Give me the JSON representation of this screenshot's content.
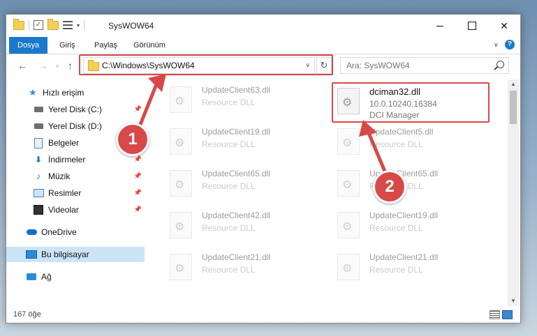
{
  "window": {
    "title": "SysWOW64",
    "min_symbol": "—",
    "close_symbol": "✕"
  },
  "ribbon": {
    "tabs": [
      {
        "label": "Dosya",
        "active": true
      },
      {
        "label": "Giriş",
        "active": false
      },
      {
        "label": "Paylaş",
        "active": false
      },
      {
        "label": "Görünüm",
        "active": false
      }
    ],
    "help_label": "?"
  },
  "navigation": {
    "back_icon": "←",
    "forward_icon": "→",
    "up_icon": "↑",
    "address": "C:\\Windows\\SysWOW64",
    "refresh_icon": "↻",
    "search_placeholder": "Ara: SysWOW64"
  },
  "sidebar": {
    "items": [
      {
        "label": "Hızlı erişim",
        "icon": "star-icon"
      },
      {
        "label": "Yerel Disk (C:)",
        "icon": "drive-icon",
        "pinned": true
      },
      {
        "label": "Yerel Disk (D:)",
        "icon": "drive-icon",
        "pinned": false
      },
      {
        "label": "Belgeler",
        "icon": "documents-icon",
        "pinned": true
      },
      {
        "label": "İndirmeler",
        "icon": "downloads-icon",
        "pinned": true
      },
      {
        "label": "Müzik",
        "icon": "music-icon",
        "pinned": true
      },
      {
        "label": "Resimler",
        "icon": "pictures-icon",
        "pinned": true
      },
      {
        "label": "Videolar",
        "icon": "videos-icon",
        "pinned": true
      },
      {
        "label": "OneDrive",
        "icon": "onedrive-icon"
      },
      {
        "label": "Bu bilgisayar",
        "icon": "this-pc-icon",
        "selected": true
      },
      {
        "label": "Ağ",
        "icon": "network-icon"
      }
    ]
  },
  "files": {
    "left_column": [
      {
        "name": "UpdateClient63.dll",
        "type": "Resource DLL"
      },
      {
        "name": "UpdateClient19.dll",
        "type": "Resource DLL"
      },
      {
        "name": "UpdateClient65.dll",
        "type": "Resource DLL"
      },
      {
        "name": "UpdateClient42.dll",
        "type": "Resource DLL"
      },
      {
        "name": "UpdateClient21.dll",
        "type": "Resource DLL"
      }
    ],
    "featured": {
      "name": "dciman32.dll",
      "version": "10.0.10240.16384",
      "description": "DCI Manager"
    },
    "right_column": [
      {
        "name": "UpdateClient5.dll",
        "type": "Resource DLL"
      },
      {
        "name": "UpdateClient65.dll",
        "type": "Resource DLL"
      },
      {
        "name": "UpdateClient19.dll",
        "type": "Resource DLL"
      },
      {
        "name": "UpdateClient21.dll",
        "type": "Resource DLL"
      }
    ]
  },
  "status": {
    "item_count": "167 öğe"
  },
  "callouts": [
    {
      "label": "1"
    },
    {
      "label": "2"
    }
  ],
  "colors": {
    "accent": "#1979ca",
    "highlight": "#d94848",
    "selected_bg": "#cce4f7"
  }
}
